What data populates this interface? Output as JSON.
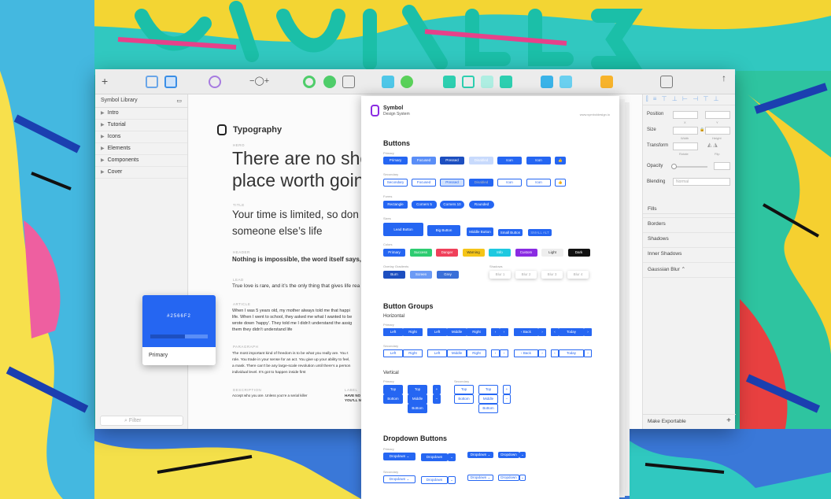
{
  "colors": {
    "primary": "#2566F2",
    "success": "#2ecc71",
    "danger": "#f0405a",
    "warning": "#f5c518",
    "info": "#1ec9e0",
    "custom": "#8a2be2",
    "light": "#eeeeee",
    "dark": "#111111"
  },
  "toolbar": {
    "icons": [
      "insert-icon",
      "group-icon",
      "ungroup-icon",
      "symbol-icon",
      "zoom-icon",
      "rotate-icon",
      "flatten-icon",
      "union-icon",
      "subtract-icon",
      "intersect-icon",
      "difference-icon",
      "forward-icon",
      "backward-icon",
      "sketch-icon",
      "view-icon",
      "export-icon"
    ],
    "zoom_minus": "−",
    "zoom_plus": "+"
  },
  "sidebar": {
    "header": "Symbol Library",
    "items": [
      {
        "label": "Intro"
      },
      {
        "label": "Tutorial"
      },
      {
        "label": "Icons"
      },
      {
        "label": "Elements"
      },
      {
        "label": "Components"
      },
      {
        "label": "Cover"
      }
    ],
    "filter_placeholder": "Filter"
  },
  "inspector": {
    "position": "Position",
    "x": "X",
    "y": "Y",
    "size": "Size",
    "width": "Width",
    "height": "Height",
    "transform": "Transform",
    "rotate": "Rotate",
    "flip": "Flip",
    "opacity": "Opacity",
    "blending": "Blending",
    "blending_value": "Normal",
    "fills": "Fills",
    "borders": "Borders",
    "shadows": "Shadows",
    "inner_shadows": "Inner Shadows",
    "gaussian_blur": "Gaussian Blur",
    "make_exportable": "Make Exportable",
    "add": "+"
  },
  "typo": {
    "title": "Typography",
    "hero_lbl": "HERO",
    "hero": "There are no sho",
    "hero2": "place worth goin",
    "title_lbl": "TITLE",
    "title_txt": "Your time is limited, so don",
    "title_txt2": "someone else’s life",
    "header_lbl": "HEADER",
    "header_txt": "Nothing is impossible, the word itself says, I’m",
    "lead_lbl": "LEAD",
    "lead_txt": "True love is rare, and it’s the only thing that gives life rea",
    "article_lbl": "ARTICLE",
    "article": [
      "When I was 5 years old, my mother always told me that happi",
      "life. When I went to school, they asked me what I wanted to be",
      "wrote down ‘happy’. They told me I didn’t understand the assig",
      "them they didn’t understand life"
    ],
    "para_lbl": "PARAGRAPH",
    "para": [
      "The most important kind of freedom is to be what you really are. You t",
      "role. You trade in your sense for an act. You give up your ability to feel,",
      "a mask. There can’t be any large-scale revolution until there’s a person",
      "individual level. It’s got to happen inside first"
    ],
    "desc_lbl": "DESCRIPTION",
    "desc": "Accept who you are. Unless you’re a serial killer",
    "label_lbl": "LABEL",
    "label1": "HAVE NO",
    "label2": "YOU’LL N"
  },
  "swatch": {
    "hex": "#2566F2",
    "name": "Primary"
  },
  "doc": {
    "brand": "Symbol",
    "brand2": "Design System",
    "url": "www.symboldesign.io",
    "buttons": "Buttons",
    "primary": "Primary",
    "secondary": "Secondary",
    "forms": "Forms",
    "sizes": "Sizes",
    "colors_lbl": "Colors",
    "overlay": "Overlay Gradients",
    "shadows": "Shadows",
    "row1": [
      "Primary",
      "Focused",
      "Pressed",
      "Disabled",
      "Icon",
      "Icon",
      "👍"
    ],
    "row2": [
      "Secondary",
      "Focused",
      "Pressed",
      "Disabled",
      "Icon",
      "Icon",
      "👍"
    ],
    "row3": [
      "Rectangle",
      "Corners 5",
      "Corners 10",
      "Rounded"
    ],
    "row4": [
      "Lead Button",
      "Big Button",
      "Middle Button",
      "Small Button",
      "SMALL ALT"
    ],
    "row5": [
      "Primary",
      "Success",
      "Danger",
      "Warning",
      "Info",
      "Custom",
      "Light",
      "Dark"
    ],
    "row6": [
      "Burn",
      "Screen",
      "Grey"
    ],
    "row7": [
      "Blur 1",
      "Blur 2",
      "Blur 3",
      "Blur 4"
    ],
    "groups": "Button Groups",
    "horizontal": "Horizontal",
    "vertical": "Vertical",
    "h1": [
      "Left",
      "Right"
    ],
    "h2": [
      "Left",
      "Middle",
      "Right"
    ],
    "back": "Back",
    "today": "Today",
    "top": "Top",
    "bottom": "Bottom",
    "middle": "Middle",
    "dropdowns": "Dropdown Buttons",
    "dropdown": "Dropdown"
  }
}
